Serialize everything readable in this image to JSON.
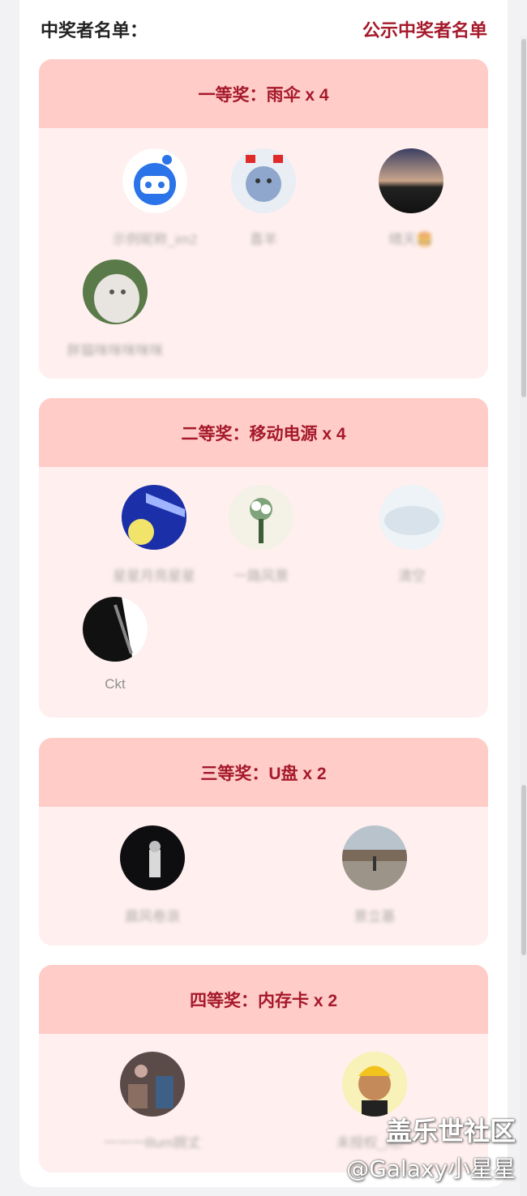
{
  "header": {
    "title": "中奖者名单：",
    "public_link": "公示中奖者名单"
  },
  "prizes": [
    {
      "title": "一等奖：雨伞 x 4",
      "winners": [
        {
          "name": "示例昵称_im2",
          "avatar": "robot-avatar"
        },
        {
          "name": "喜羊",
          "avatar": "cartoon-avatar"
        },
        {
          "name": "晴天🍔",
          "avatar": "sunset-avatar"
        },
        {
          "name": "胖猫咪咪咪咪咪",
          "avatar": "cat-avatar"
        }
      ]
    },
    {
      "title": "二等奖：移动电源 x 4",
      "winners": [
        {
          "name": "星星月亮星星",
          "avatar": "moon-avatar"
        },
        {
          "name": "一路风景",
          "avatar": "bouquet-avatar"
        },
        {
          "name": "清空",
          "avatar": "cloud-avatar"
        },
        {
          "name": "Ckt",
          "avatar": "bw-avatar"
        }
      ]
    },
    {
      "title": "三等奖：U盘 x 2",
      "winners": [
        {
          "name": "晨风卷浪",
          "avatar": "dark-avatar"
        },
        {
          "name": "景立基",
          "avatar": "plaza-avatar"
        }
      ]
    },
    {
      "title": "四等奖：内存卡 x 2",
      "winners": [
        {
          "name": "一一一lllum婉丈",
          "avatar": "photo-avatar"
        },
        {
          "name": "未授权_用户",
          "avatar": "boy-avatar"
        }
      ]
    }
  ],
  "watermark": {
    "line1": "盖乐世社区",
    "line2": "@Galaxy小星星"
  },
  "colors": {
    "accent": "#a5192a",
    "prize_header_bg": "#ffccc8",
    "prize_body_bg": "#fff0ef",
    "name_text": "#8e8e8e"
  }
}
